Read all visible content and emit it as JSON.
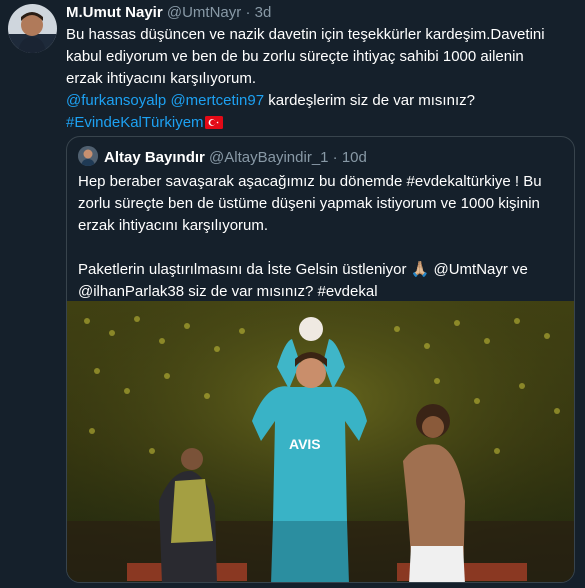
{
  "tweet": {
    "author": {
      "name": "M.Umut Nayir",
      "handle": "@UmtNayr",
      "time": "3d"
    },
    "text": {
      "line1": "Bu hassas düşüncen ve nazik davetin için teşekkürler kardeşim.Davetini",
      "line2": "kabul ediyorum ve ben de bu zorlu süreçte ihtiyaç sahibi 1000 ailenin",
      "line3": "erzak ihtiyacını karşılıyorum.",
      "mention1": "@furkansoyalp",
      "mention2": "@mertcetin97",
      "line4_rest": " kardeşlerim siz de var mısınız?",
      "hashtag": "#EvindeKalTürkiyem"
    },
    "flag_icon": "turkey-flag-icon"
  },
  "quoted": {
    "author": {
      "name": "Altay Bayındır",
      "handle": "@AltayBayindir_1",
      "time": "10d"
    },
    "text": {
      "line1": "Hep beraber savaşarak aşacağımız bu dönemde #evdekaltürkiye ! Bu",
      "line2": "zorlu süreçte ben de üstüme düşeni yapmak istiyorum ve 1000 kişinin",
      "line3": "erzak ihtiyacını karşılıyorum.",
      "line4": "Paketlerin ulaştırılmasını da İste Gelsin üstleniyor 🙏🏼 @UmtNayr ve",
      "line5": "@ilhanParlak38 siz de var mısınız? #evdekal"
    },
    "media_sponsor_text": "AVIS"
  },
  "colors": {
    "background": "#15202b",
    "text": "#ffffff",
    "muted": "#8899a6",
    "link": "#1da1f2",
    "border": "#38444d"
  }
}
